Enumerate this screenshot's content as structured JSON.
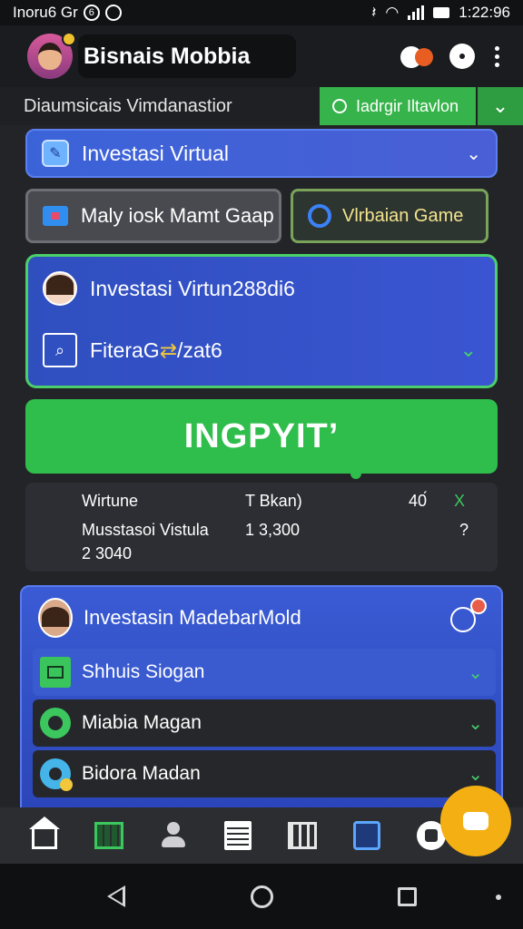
{
  "status_bar": {
    "left_text": "Inoru6 Gr",
    "left_glyph": "6",
    "time": "1:22:96"
  },
  "app_bar": {
    "title": "Bisnais Mobbia",
    "icons": [
      "avatar",
      "mascot-icon",
      "circle-icon",
      "more-icon"
    ]
  },
  "sub_bar": {
    "label": "Diaumsicais Vimdanastior",
    "search_button": "Iadrgir Iltavlon"
  },
  "dropdown_primary": {
    "label": "Investasi Virtual"
  },
  "action_buttons": {
    "left": "Maly iosk Mamt Gaap",
    "right": "Vlrbaian Game"
  },
  "investment_card": {
    "title": "Investasi Virtun288di6",
    "filter_label": "FiteraG",
    "filter_suffix": "/zat6"
  },
  "cta": {
    "label": "INGPYIT’"
  },
  "stats": {
    "row1": {
      "label": "Wirtune",
      "value": "T Bkan)",
      "amount": "40́",
      "mark": "X"
    },
    "row2": {
      "label": "Musstasoi Vistula",
      "value": "1 3,300",
      "mark": "?"
    },
    "row3": {
      "label": "2 3040"
    }
  },
  "list_panel": {
    "header": "Investasin MadebarMold",
    "items": [
      {
        "label": "Shhuis Siogan"
      },
      {
        "label": "Miabia Magan"
      },
      {
        "label": "Bidora Madan"
      }
    ]
  },
  "colors": {
    "accent_green": "#2fbd4c",
    "accent_blue": "#3b63d8",
    "fab_yellow": "#f4b012",
    "background": "#232427"
  }
}
